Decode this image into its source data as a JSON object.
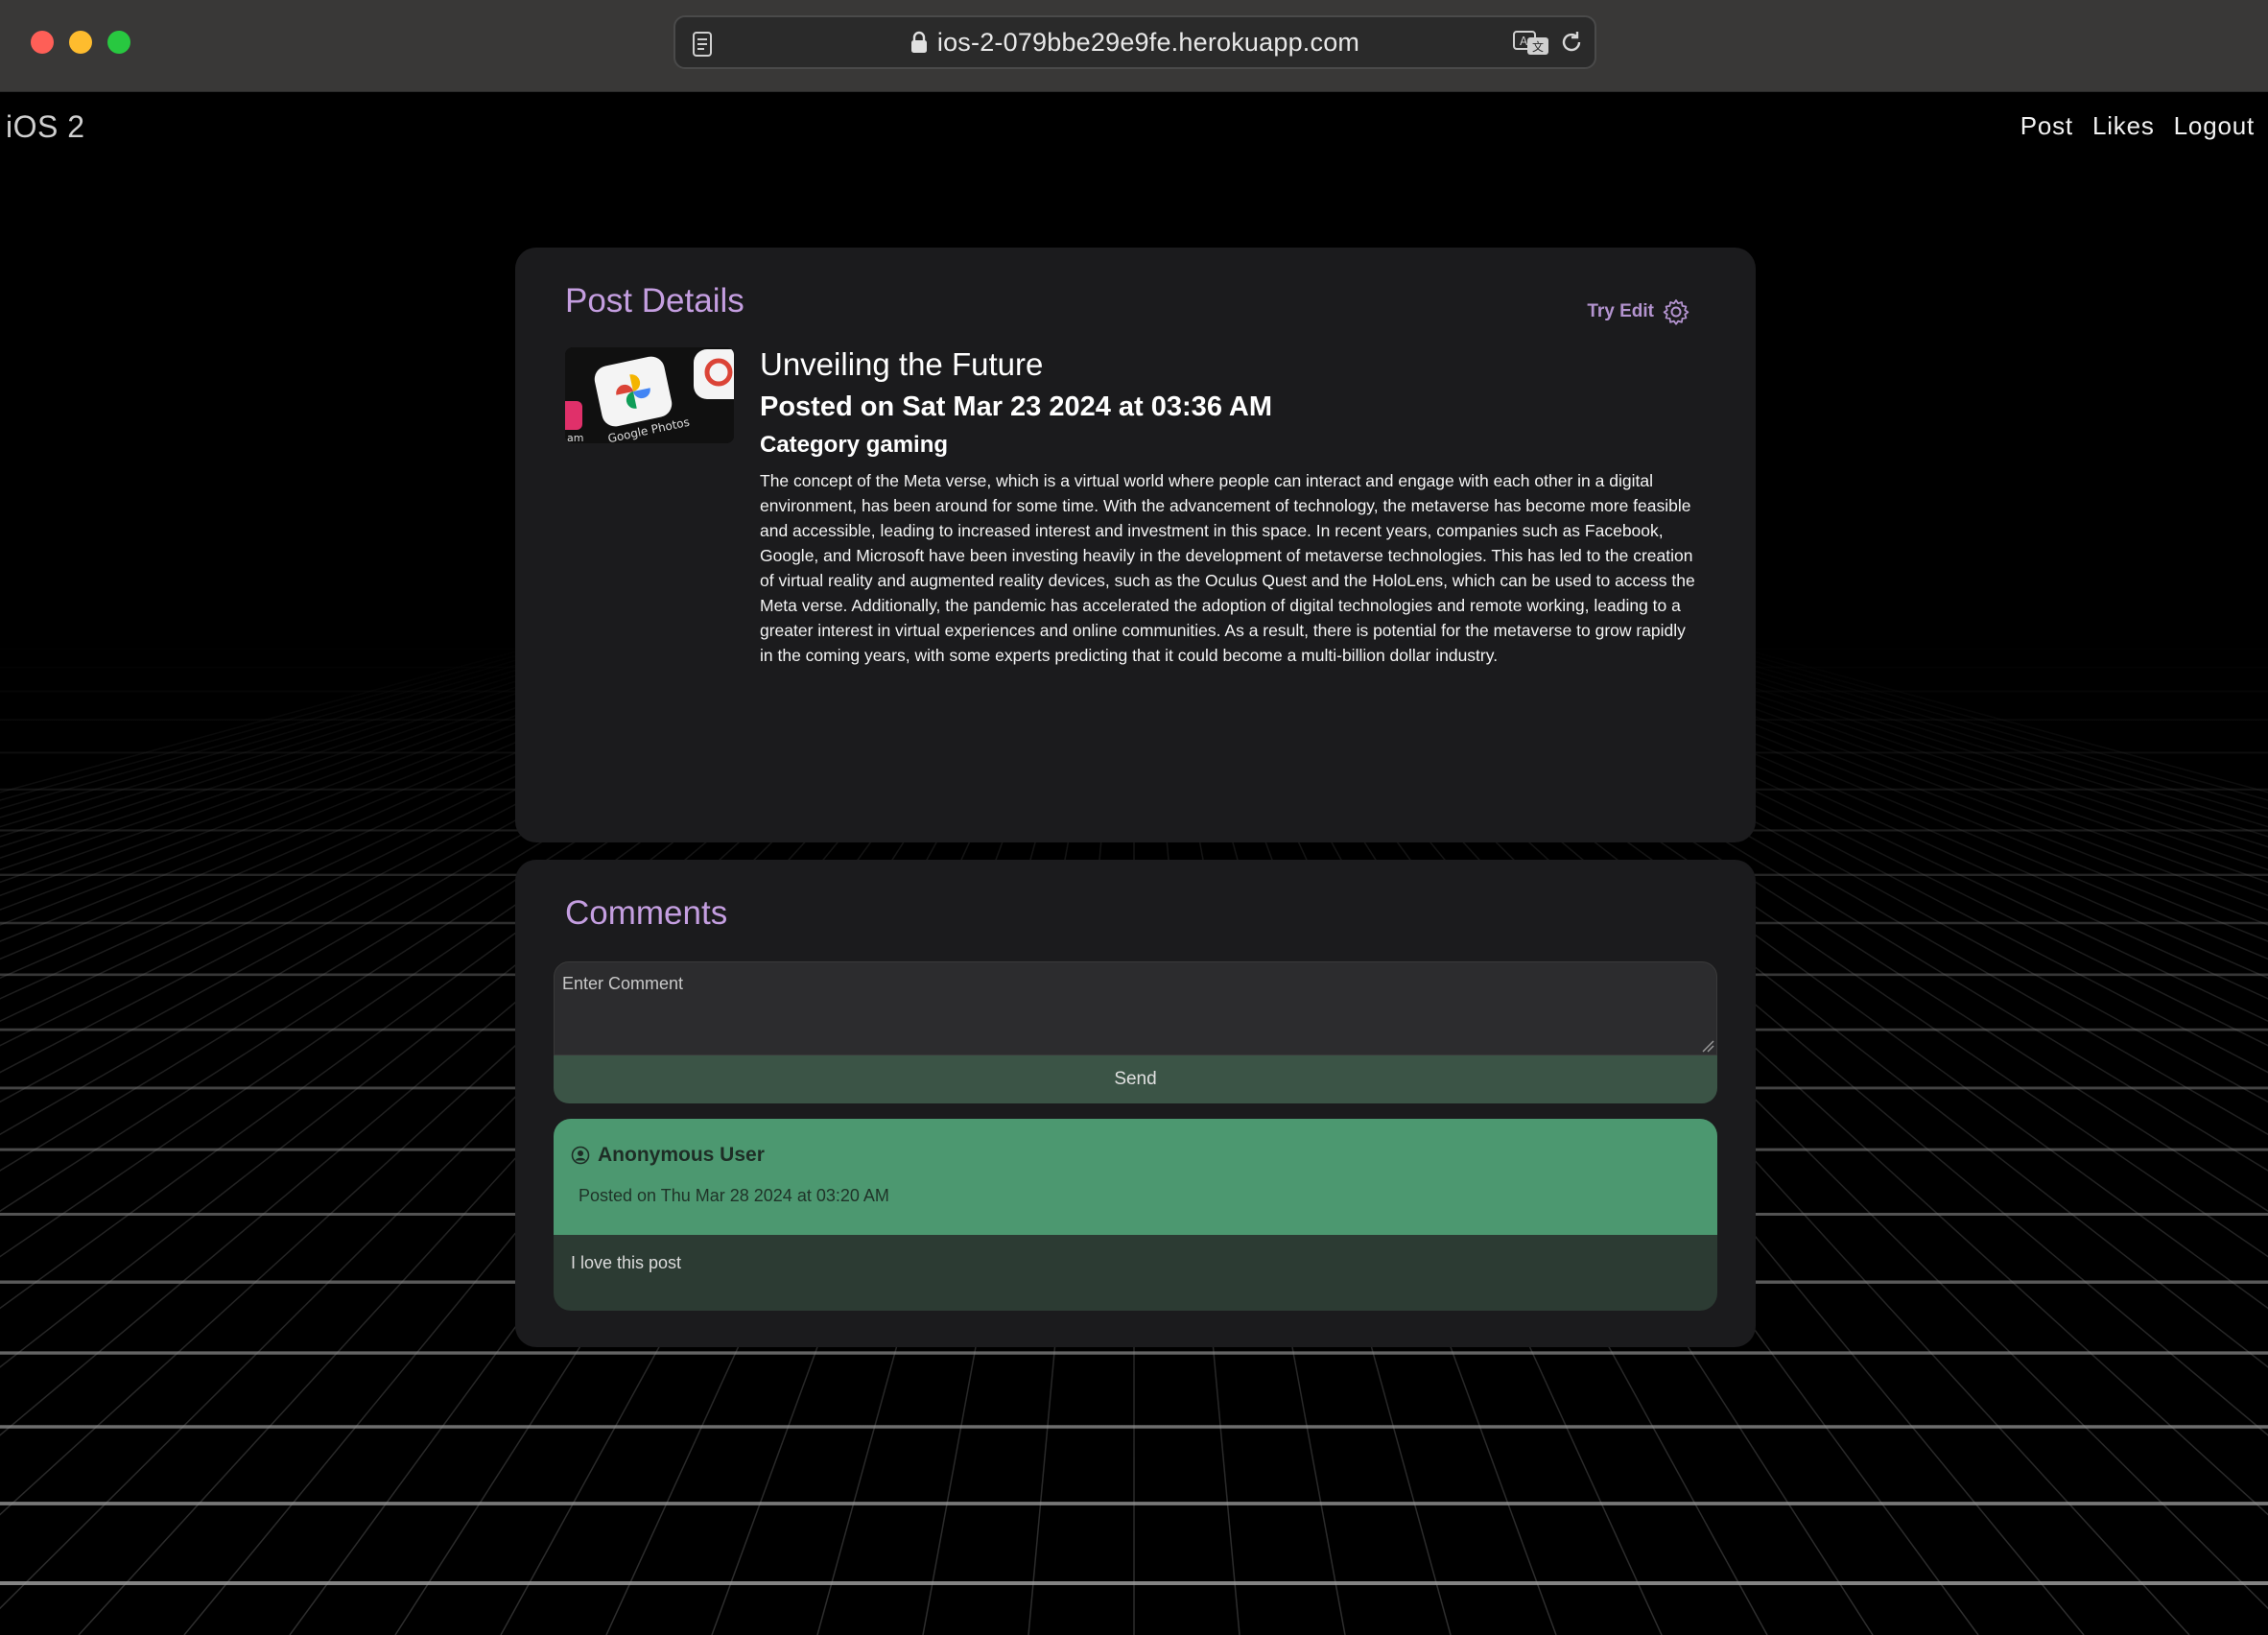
{
  "browser": {
    "url": "ios-2-079bbe29e9fe.herokuapp.com",
    "icons": [
      "reader-icon",
      "lock-icon",
      "translate-icon",
      "reload-icon"
    ]
  },
  "navbar": {
    "brand": "iOS 2",
    "links": [
      "Post",
      "Likes",
      "Logout"
    ]
  },
  "post_details": {
    "section_title": "Post Details",
    "try_edit_label": "Try Edit",
    "thumbnail_caption": "Google Photos",
    "title": "Unveiling the Future",
    "posted_on": "Posted on Sat Mar 23 2024 at 03:36 AM",
    "category": "Category gaming",
    "body": "The concept of the Meta verse, which is a virtual world where people can interact and engage with each other in a digital environment, has been around for some time. With the advancement of technology, the metaverse has become more feasible and accessible, leading to increased interest and investment in this space. In recent years, companies such as Facebook, Google, and Microsoft have been investing heavily in the development of metaverse technologies. This has led to the creation of virtual reality and augmented reality devices, such as the Oculus Quest and the HoloLens, which can be used to access the Meta verse. Additionally, the pandemic has accelerated the adoption of digital technologies and remote working, leading to a greater interest in virtual experiences and online communities. As a result, there is potential for the metaverse to grow rapidly in the coming years, with some experts predicting that it could become a multi-billion dollar industry."
  },
  "comments": {
    "section_title": "Comments",
    "input_placeholder": "Enter Comment",
    "send_label": "Send",
    "items": [
      {
        "user": "Anonymous User",
        "posted_on": "Posted on Thu Mar 28 2024 at 03:20 AM",
        "text": "I love this post"
      }
    ]
  },
  "colors": {
    "accent_purple": "#c49ee0",
    "comment_header_green": "#4c9870",
    "send_button": "#3b5446",
    "card_bg": "#1b1b1d"
  }
}
